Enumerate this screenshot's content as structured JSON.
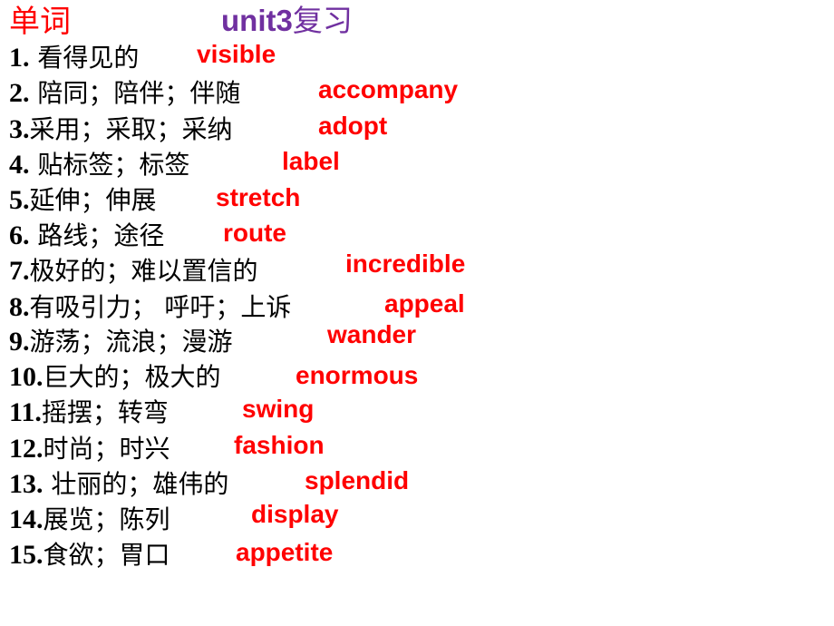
{
  "header": {
    "section_label": "单词",
    "unit_prefix": "unit3",
    "unit_suffix": "复习",
    "colors": {
      "section": "#ff0000",
      "unit": "#7030a0",
      "answer": "#ff0000"
    }
  },
  "vocabulary": [
    {
      "num": "1.",
      "meaning": " 看得见的",
      "word": "visible"
    },
    {
      "num": "2.",
      "meaning": " 陪同；陪伴；伴随",
      "word": "accompany"
    },
    {
      "num": "3.",
      "meaning": "采用；采取；采纳",
      "word": "adopt"
    },
    {
      "num": "4.",
      "meaning": " 贴标签；标签",
      "word": "label"
    },
    {
      "num": "5.",
      "meaning": "延伸；伸展",
      "word": "stretch"
    },
    {
      "num": "6.",
      "meaning": " 路线；途径",
      "word": "route"
    },
    {
      "num": "7.",
      "meaning": "极好的；难以置信的",
      "word": "incredible"
    },
    {
      "num": "8.",
      "meaning": "有吸引力； 呼吁；上诉",
      "word": "appeal"
    },
    {
      "num": "9.",
      "meaning": "游荡；流浪；漫游",
      "word": "wander"
    },
    {
      "num": "10.",
      "meaning": "巨大的；极大的",
      "word": "enormous"
    },
    {
      "num": "11.",
      "meaning": "摇摆；转弯",
      "word": "swing"
    },
    {
      "num": "12.",
      "meaning": "时尚；时兴",
      "word": "fashion"
    },
    {
      "num": "13.",
      "meaning": " 壮丽的；雄伟的",
      "word": "splendid"
    },
    {
      "num": "14.",
      "meaning": "展览；陈列",
      "word": "display"
    },
    {
      "num": "15.",
      "meaning": "食欲；胃口",
      "word": "appetite"
    }
  ]
}
